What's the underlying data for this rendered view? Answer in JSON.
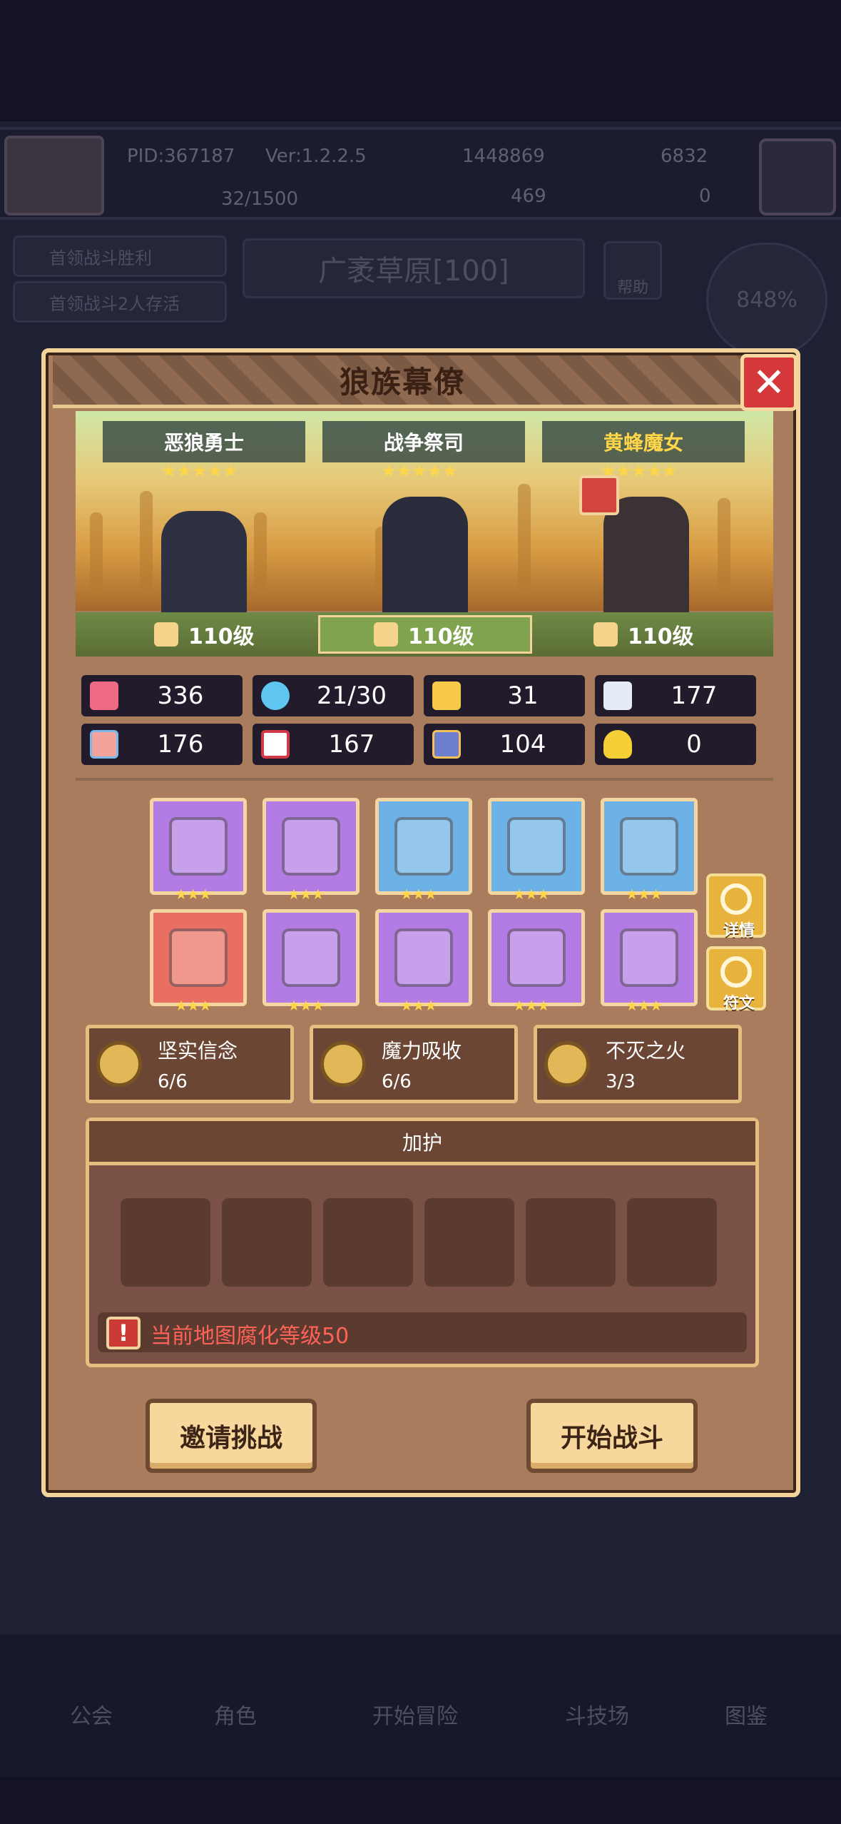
{
  "hud": {
    "pid": "PID:367187",
    "version": "Ver:1.2.2.5",
    "gold": "1448869",
    "gems": "6832",
    "exp": "32/1500",
    "clover": "469",
    "keys": "0"
  },
  "background": {
    "quest1": "首领战斗胜利",
    "quest2": "首领战斗2人存活",
    "map_name": "广袤草原[100]",
    "help_label": "帮助",
    "percent": "848%"
  },
  "modal": {
    "title": "狼族幕僚",
    "close_symbol": "✕",
    "heroes": [
      {
        "name": "恶狼勇士",
        "stars": "★★★★★",
        "level": "110级"
      },
      {
        "name": "战争祭司",
        "stars": "★★★★★",
        "level": "110级"
      },
      {
        "name": "黄蜂魔女",
        "stars": "★★★★★",
        "level": "110级"
      }
    ],
    "stats": {
      "hp": "336",
      "mana": "21/30",
      "defense": "31",
      "speed": "177",
      "attack": "176",
      "magic": "167",
      "armor": "104",
      "luck": "0"
    },
    "item_stars": "★★★",
    "detail_label": "详情",
    "rune_label": "符文",
    "sets": [
      {
        "name": "坚实信念",
        "count": "6/6"
      },
      {
        "name": "魔力吸收",
        "count": "6/6"
      },
      {
        "name": "不灭之火",
        "count": "3/3"
      }
    ],
    "protection": {
      "title": "加护",
      "warning_symbol": "!",
      "warning": "当前地图腐化等级50"
    },
    "invite_button": "邀请挑战",
    "start_button": "开始战斗"
  },
  "nav": {
    "guild": "公会",
    "role": "角色",
    "adventure": "开始冒险",
    "arena": "斗技场",
    "codex": "图鉴"
  },
  "colors": {
    "close": "#d5383b",
    "warning_text": "#ff6257",
    "star": "#ffd64a",
    "panel_border": "#f2d39a"
  }
}
